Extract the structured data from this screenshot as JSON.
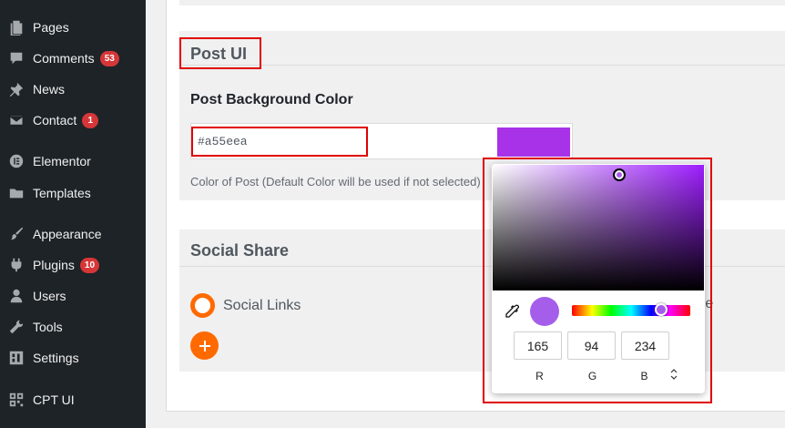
{
  "sidebar": {
    "items": [
      {
        "label": "Pages",
        "icon": "pages-icon",
        "badge": ""
      },
      {
        "label": "Comments",
        "icon": "comments-icon",
        "badge": "53"
      },
      {
        "label": "News",
        "icon": "pin-icon",
        "badge": ""
      },
      {
        "label": "Contact",
        "icon": "mail-icon",
        "badge": "1"
      },
      {
        "label": "Elementor",
        "icon": "elementor-icon",
        "badge": ""
      },
      {
        "label": "Templates",
        "icon": "folder-icon",
        "badge": ""
      },
      {
        "label": "Appearance",
        "icon": "paintbrush-icon",
        "badge": ""
      },
      {
        "label": "Plugins",
        "icon": "plugin-icon",
        "badge": "10"
      },
      {
        "label": "Users",
        "icon": "user-icon",
        "badge": ""
      },
      {
        "label": "Tools",
        "icon": "wrench-icon",
        "badge": ""
      },
      {
        "label": "Settings",
        "icon": "settings-icon",
        "badge": ""
      },
      {
        "label": "CPT UI",
        "icon": "grid-icon",
        "badge": ""
      }
    ]
  },
  "post_ui": {
    "title": "Post UI",
    "field_label": "Post Background Color",
    "color_value": "#a55eea",
    "help_text": "Color of Post (Default Color will be used if not selected)"
  },
  "social_share": {
    "title": "Social Share",
    "option_label": "Social Links",
    "option_label_2": "re"
  },
  "picker": {
    "r": "165",
    "g": "94",
    "b": "234",
    "r_label": "R",
    "g_label": "G",
    "b_label": "B",
    "saturation": 0.6,
    "value": 0.92,
    "hue": 270
  },
  "colors": {
    "selected": "#a55eea",
    "swatch": "#a832e8",
    "accent": "#ff6a00",
    "badge": "#d63638",
    "sidebar_bg": "#1d2327",
    "highlight": "#e00000"
  }
}
